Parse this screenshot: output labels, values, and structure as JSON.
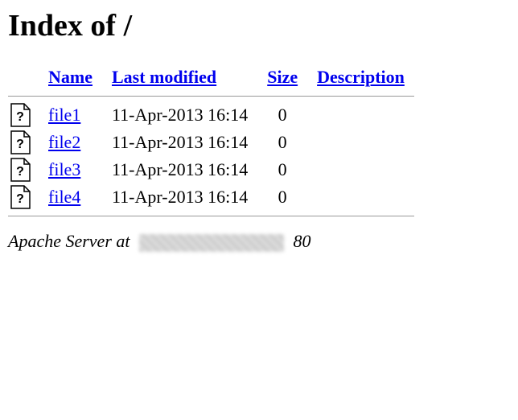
{
  "title": "Index of /",
  "columns": {
    "name": "Name",
    "modified": "Last modified",
    "size": "Size",
    "description": "Description"
  },
  "files": [
    {
      "name": "file1",
      "modified": "11-Apr-2013 16:14",
      "size": "0",
      "description": ""
    },
    {
      "name": "file2",
      "modified": "11-Apr-2013 16:14",
      "size": "0",
      "description": ""
    },
    {
      "name": "file3",
      "modified": "11-Apr-2013 16:14",
      "size": "0",
      "description": ""
    },
    {
      "name": "file4",
      "modified": "11-Apr-2013 16:14",
      "size": "0",
      "description": ""
    }
  ],
  "footer": {
    "prefix": "Apache Server at ",
    "suffix": " 80"
  }
}
